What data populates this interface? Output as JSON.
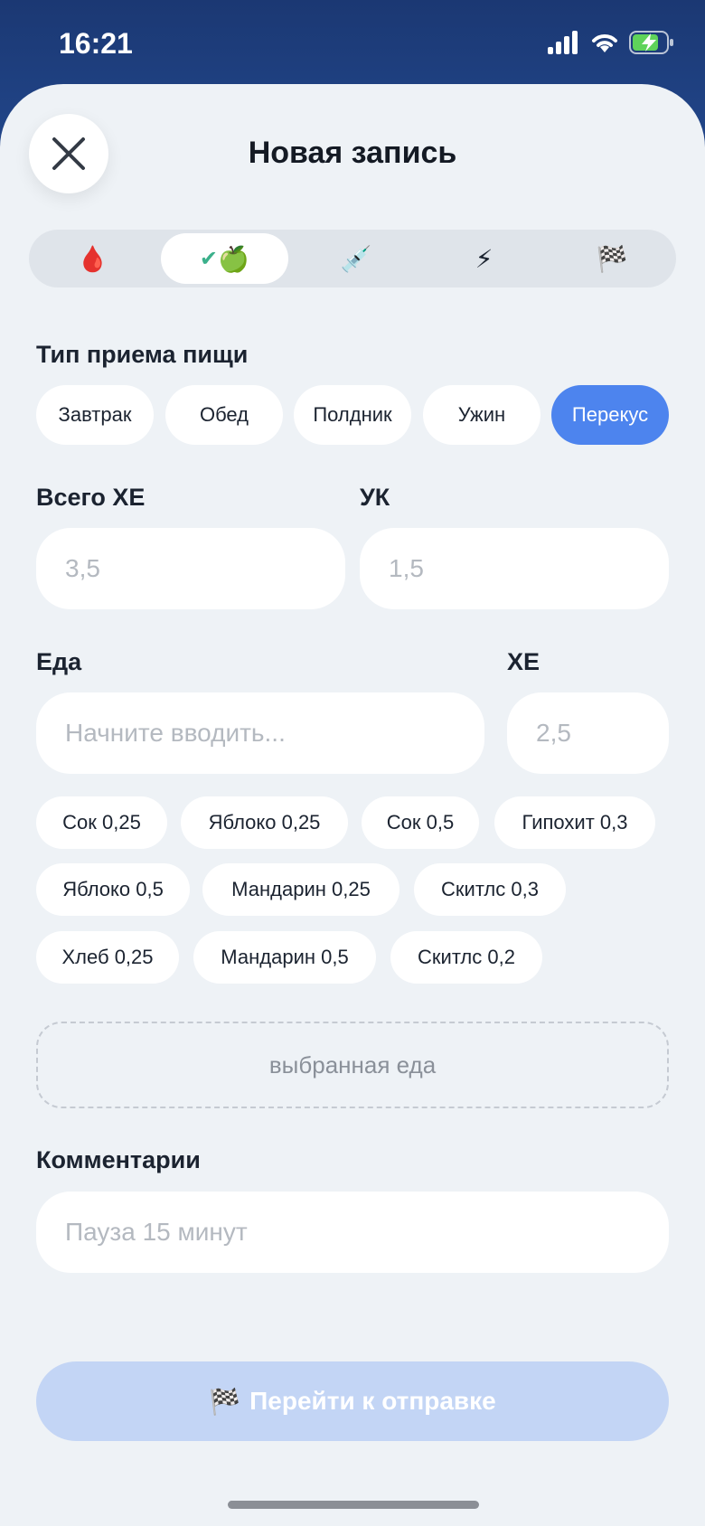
{
  "status": {
    "time": "16:21"
  },
  "header": {
    "title": "Новая запись",
    "close_icon": "close-icon"
  },
  "tabs": [
    {
      "icon": "blood-drop-icon",
      "glyph": "🩸"
    },
    {
      "icon": "check-apple-icon",
      "glyph_check": "✔",
      "glyph_apple": "🍏",
      "active": true
    },
    {
      "icon": "syringe-icon",
      "glyph": "💉"
    },
    {
      "icon": "lightning-icon",
      "glyph": "⚡"
    },
    {
      "icon": "checkered-flag-icon",
      "glyph": "🏁"
    }
  ],
  "meal_type": {
    "label": "Тип приема пищи",
    "options": [
      "Завтрак",
      "Обед",
      "Полдник",
      "Ужин",
      "Перекус"
    ],
    "selected": "Перекус"
  },
  "totals": {
    "total_xe_label": "Всего ХЕ",
    "total_xe_placeholder": "3,5",
    "uk_label": "УК",
    "uk_placeholder": "1,5"
  },
  "food": {
    "label": "Еда",
    "placeholder": "Начните вводить...",
    "xe_label": "ХЕ",
    "xe_placeholder": "2,5",
    "suggestions": [
      "Сок 0,25",
      "Яблоко 0,25",
      "Сок 0,5",
      "Гипохит 0,3",
      "Яблоко 0,5",
      "Мандарин 0,25",
      "Скитлс 0,3",
      "Хлеб 0,25",
      "Мандарин 0,5",
      "Скитлс 0,2"
    ],
    "selected_placeholder": "выбранная еда"
  },
  "comments": {
    "label": "Комментарии",
    "placeholder": "Пауза 15 минут"
  },
  "submit": {
    "label": "Перейти к отправке",
    "glyph": "🏁"
  },
  "colors": {
    "accent": "#4d84ee",
    "background": "#eef2f6",
    "header": "#1e3d7a",
    "submit_disabled": "#c3d5f5"
  }
}
